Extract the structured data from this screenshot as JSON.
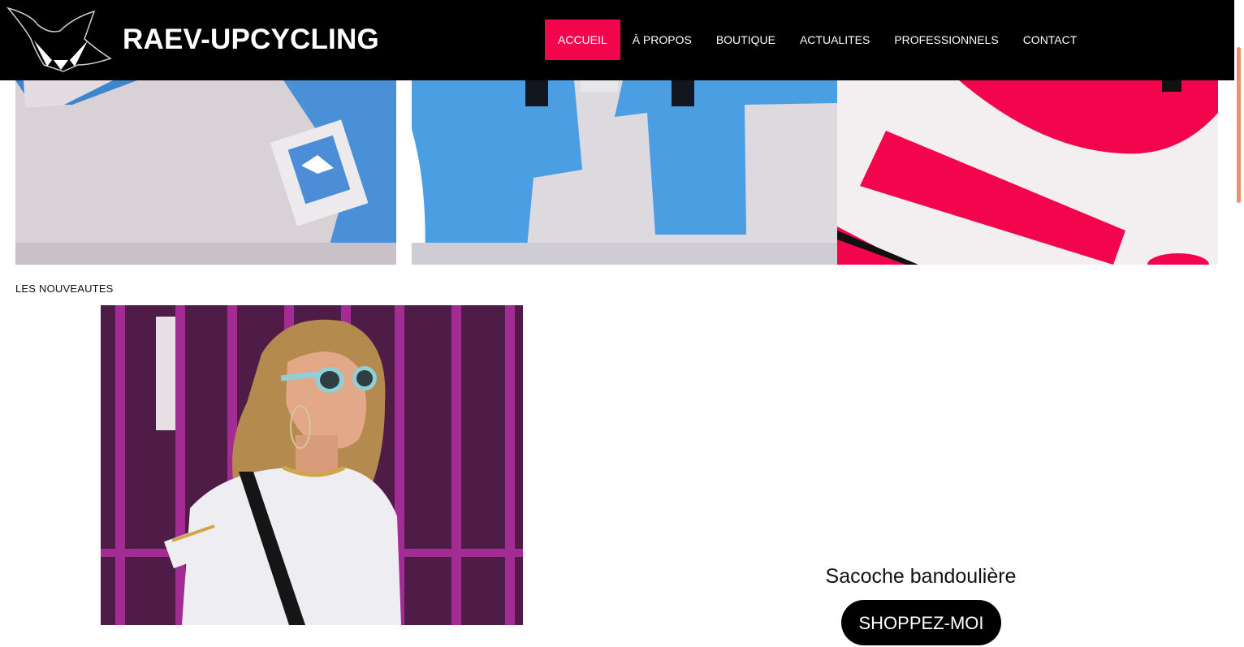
{
  "header": {
    "brand": "RAEV-UPCYCLING",
    "logo_icon": "fox-logo-icon",
    "nav": [
      {
        "label": "ACCUEIL",
        "active": true
      },
      {
        "label": "À PROPOS",
        "active": false
      },
      {
        "label": "BOUTIQUE",
        "active": false
      },
      {
        "label": "ACTUALITES",
        "active": false
      },
      {
        "label": "PROFESSIONNELS",
        "active": false
      },
      {
        "label": "CONTACT",
        "active": false
      }
    ]
  },
  "hero_images": [
    {
      "subject": "grey-blue tarp bag with logo patch"
    },
    {
      "subject": "white-blue tarp tote bag"
    },
    {
      "subject": "white-red tarp bag"
    }
  ],
  "new_items": {
    "title": "LES NOUVEAUTES",
    "product_name": "Sacoche bandoulière",
    "button_label": "SHOPPEZ-MOI"
  },
  "colors": {
    "header_bg": "#000000",
    "accent": "#f2054c",
    "scroll_thumb": "#e8936b"
  }
}
